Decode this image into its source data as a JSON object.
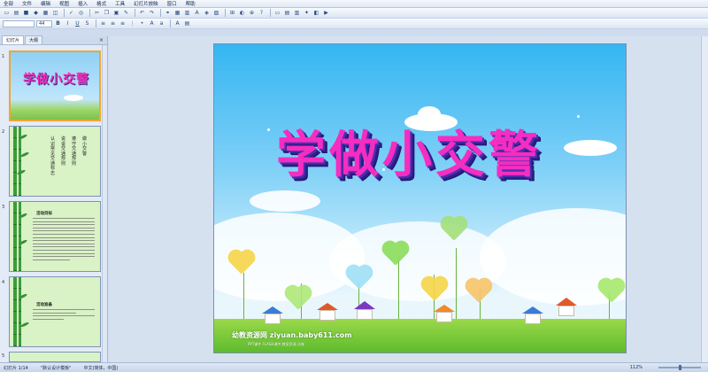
{
  "menu": [
    "全部",
    "文件",
    "编辑",
    "视图",
    "插入",
    "格式",
    "工具",
    "幻灯片放映",
    "窗口",
    "帮助"
  ],
  "toolbar": {
    "font_name": "",
    "font_size": "44"
  },
  "panel": {
    "tabs": [
      "幻灯片",
      "大纲"
    ],
    "close_glyph": "×"
  },
  "thumbnails": [
    {
      "num": "1",
      "title": "学做小交警"
    },
    {
      "num": "2",
      "items": [
        "认识常见交通标志",
        "说说交通规则",
        "遵守交通规则",
        "做小交警"
      ]
    },
    {
      "num": "3",
      "heading": "活动目标"
    },
    {
      "num": "4",
      "heading": "活动准备"
    },
    {
      "num": "5"
    }
  ],
  "slide": {
    "title": "学做小交警",
    "watermark": "幼教资源网 ziyuan.baby611.com",
    "watermark_sub": "PPT课件 FLASH课件 教案资源 试卷"
  },
  "status": {
    "slide_counter": "幻灯片 1/14",
    "design": "\"默认设计模板\"",
    "language": "中文(简体，中国)",
    "zoom": "112%"
  },
  "colors": {
    "title": "#f52dc0",
    "title_shadow": "#2c1f86",
    "sky": "#35b6f2",
    "grass": "#5dbb2d",
    "selection": "#f3a531"
  }
}
